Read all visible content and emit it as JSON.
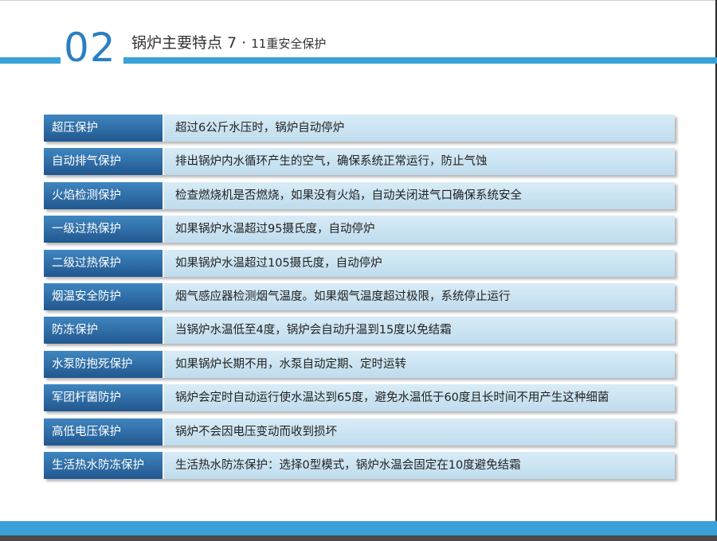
{
  "header": {
    "section_number": "02",
    "title_main": "锅炉主要特点 7 ·",
    "title_sub": "11重安全保护"
  },
  "protections": [
    {
      "label": "超压保护",
      "description": "超过6公斤水压时，锅炉自动停炉"
    },
    {
      "label": "自动排气保护",
      "description": "排出锅炉内水循环产生的空气，确保系统正常运行，防止气蚀"
    },
    {
      "label": "火焰检测保护",
      "description": "检查燃烧机是否燃烧，如果没有火焰，自动关闭进气口确保系统安全"
    },
    {
      "label": "一级过热保护",
      "description": "如果锅炉水温超过95摄氏度，自动停炉"
    },
    {
      "label": "二级过热保护",
      "description": "如果锅炉水温超过105摄氏度，自动停炉"
    },
    {
      "label": "烟温安全防护",
      "description": "烟气感应器检测烟气温度。如果烟气温度超过极限，系统停止运行"
    },
    {
      "label": "防冻保护",
      "description": "当锅炉水温低至4度，锅炉会自动升温到15度以免结霜"
    },
    {
      "label": "水泵防抱死保护",
      "description": "如果锅炉长期不用，水泵自动定期、定时运转"
    },
    {
      "label": "军团杆菌防护",
      "description": "锅炉会定时自动运行使水温达到65度，避免水温低于60度且长时间不用产生这种细菌"
    },
    {
      "label": "高低电压保护",
      "description": "锅炉不会因电压变动而收到损坏"
    },
    {
      "label": "生活热水防冻保护",
      "description": "生活热水防冻保护：选择0型模式，锅炉水温会固定在10度避免结霜"
    }
  ]
}
